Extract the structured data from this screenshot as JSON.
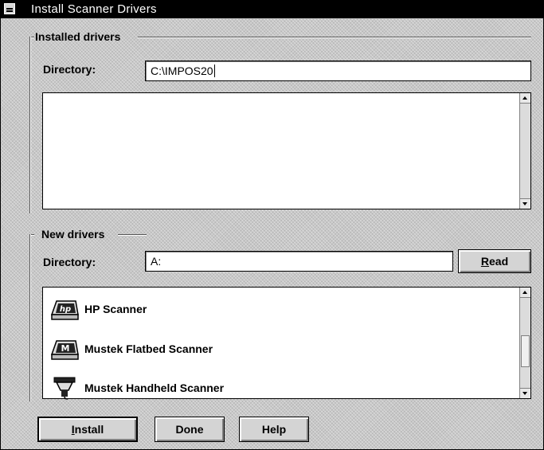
{
  "window": {
    "title": "Install Scanner Drivers"
  },
  "installed": {
    "legend": "Installed drivers",
    "directory_label": "Directory:",
    "directory_value": "C:\\IMPOS20",
    "items": []
  },
  "new_drivers": {
    "legend": "New drivers",
    "directory_label": "Directory:",
    "directory_value": "A:",
    "read_button": {
      "mnemonic": "R",
      "rest": "ead"
    },
    "items": [
      {
        "label": "HP Scanner",
        "icon": "hp-scanner-icon"
      },
      {
        "label": "Mustek Flatbed Scanner",
        "icon": "mustek-flatbed-icon"
      },
      {
        "label": "Mustek Handheld Scanner",
        "icon": "handheld-scanner-icon"
      }
    ]
  },
  "buttons": {
    "install": {
      "mnemonic": "I",
      "rest": "nstall"
    },
    "done": "Done",
    "help": "Help"
  }
}
